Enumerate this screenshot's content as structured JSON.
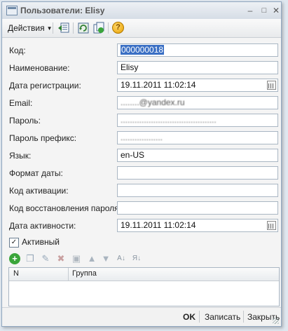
{
  "window": {
    "title": "Пользователи: Elisy"
  },
  "toolbar": {
    "actions_label": "Действия",
    "help_glyph": "?"
  },
  "form": {
    "code_label": "Код:",
    "code_value": "000000018",
    "name_label": "Наименование:",
    "name_value": "Elisy",
    "reg_date_label": "Дата регистрации:",
    "reg_date_value": "19.11.2011 11:02:14",
    "email_label": "Email:",
    "email_value": "........@yandex.ru",
    "password_label": "Пароль:",
    "password_value": ".........................................",
    "password_prefix_label": "Пароль префикс:",
    "password_prefix_value": "..................",
    "language_label": "Язык:",
    "language_value": "en-US",
    "date_format_label": "Формат даты:",
    "date_format_value": "",
    "activation_code_label": "Код активации:",
    "activation_code_value": "",
    "restore_code_label": "Код восстановления пароля:",
    "restore_code_value": "",
    "activity_date_label": "Дата активности:",
    "activity_date_value": "19.11.2011 11:02:14",
    "active_label": "Активный",
    "active_checked": true
  },
  "grid": {
    "col_n": "N",
    "col_group": "Группа",
    "rows": []
  },
  "bottom": {
    "ok_label": "OK",
    "save_label": "Записать",
    "close_label": "Закрыть"
  }
}
